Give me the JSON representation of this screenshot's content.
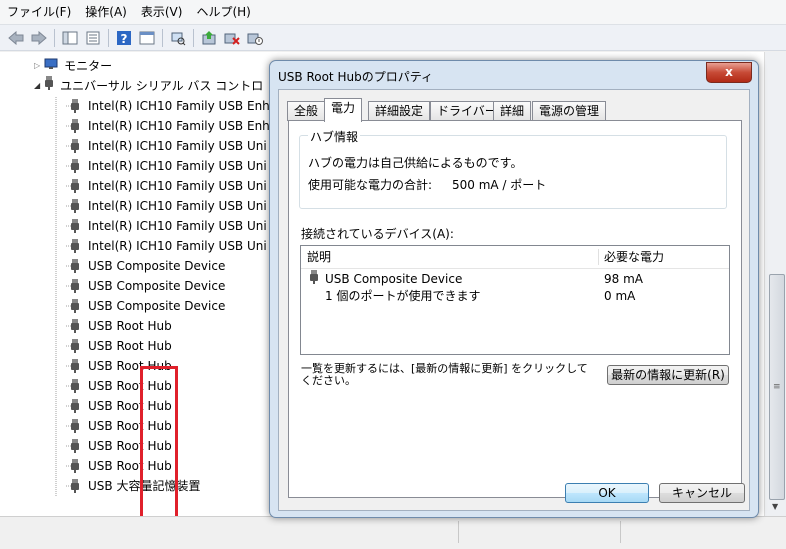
{
  "menu": [
    "ファイル(F)",
    "操作(A)",
    "表示(V)",
    "ヘルプ(H)"
  ],
  "tree": {
    "monitor": "モニター",
    "usb_controllers": "ユニバーサル シリアル バス コントロ",
    "items": [
      "Intel(R) ICH10 Family USB Enh",
      "Intel(R) ICH10 Family USB Enh",
      "Intel(R) ICH10 Family USB Uni",
      "Intel(R) ICH10 Family USB Uni",
      "Intel(R) ICH10 Family USB Uni",
      "Intel(R) ICH10 Family USB Uni",
      "Intel(R) ICH10 Family USB Uni",
      "Intel(R) ICH10 Family USB Uni",
      "USB Composite Device",
      "USB Composite Device",
      "USB Composite Device",
      "USB Root Hub",
      "USB Root Hub",
      "USB Root Hub",
      "USB Root Hub",
      "USB Root Hub",
      "USB Root Hub",
      "USB Root Hub",
      "USB Root Hub",
      "USB 大容量記憶装置"
    ]
  },
  "dialog": {
    "title": "USB Root Hubのプロパティ",
    "close": "x",
    "tabs": [
      "全般",
      "電力",
      "詳細設定",
      "ドライバー",
      "詳細",
      "電源の管理"
    ],
    "active_tab": 1,
    "hub_group_title": "ハブ情報",
    "hub_power_text": "ハブの電力は自己供給によるものです。",
    "available_power_label": "使用可能な電力の合計:",
    "available_power_value": "500 mA / ポート",
    "devices_label": "接続されているデバイス(A):",
    "columns": [
      "説明",
      "必要な電力"
    ],
    "rows": [
      {
        "desc": "USB Composite Device",
        "power": "98 mA"
      },
      {
        "desc": "1 個のポートが使用できます",
        "power": "0 mA"
      }
    ],
    "refresh_hint_line1": "一覧を更新するには、[最新の情報に更新] をクリックして",
    "refresh_hint_line2": "ください。",
    "refresh_button": "最新の情報に更新(R)",
    "ok_button": "OK",
    "cancel_button": "キャンセル"
  },
  "colors": {
    "highlight_box": "#e0202b",
    "dialog_frame": "#d7e4f2"
  }
}
